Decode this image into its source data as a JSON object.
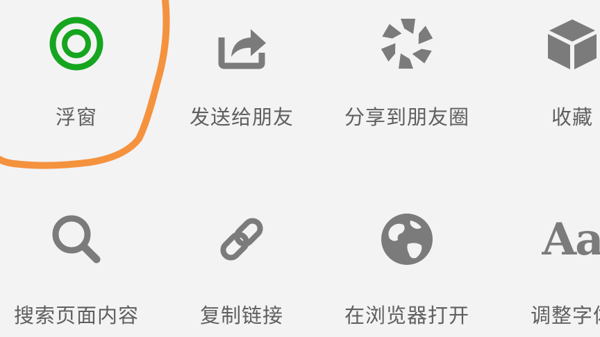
{
  "share_menu": {
    "row1": [
      {
        "label": "浮窗",
        "icon": "floating-window-icon"
      },
      {
        "label": "发送给朋友",
        "icon": "share-forward-icon"
      },
      {
        "label": "分享到朋友圈",
        "icon": "moments-aperture-icon"
      },
      {
        "label": "收藏",
        "icon": "favorites-cube-icon"
      }
    ],
    "row2": [
      {
        "label": "搜索页面内容",
        "icon": "search-icon"
      },
      {
        "label": "复制链接",
        "icon": "link-icon"
      },
      {
        "label": "在浏览器打开",
        "icon": "globe-icon"
      },
      {
        "label": "调整字体",
        "icon": "font-size-icon"
      }
    ]
  },
  "font_icon_text": "Aa",
  "colors": {
    "background": "#f3f3f4",
    "icon_gray": "#7b7b7b",
    "label_gray": "#5f5f5f",
    "floating_green": "#16a51f",
    "annotation_orange": "#f5923e"
  }
}
